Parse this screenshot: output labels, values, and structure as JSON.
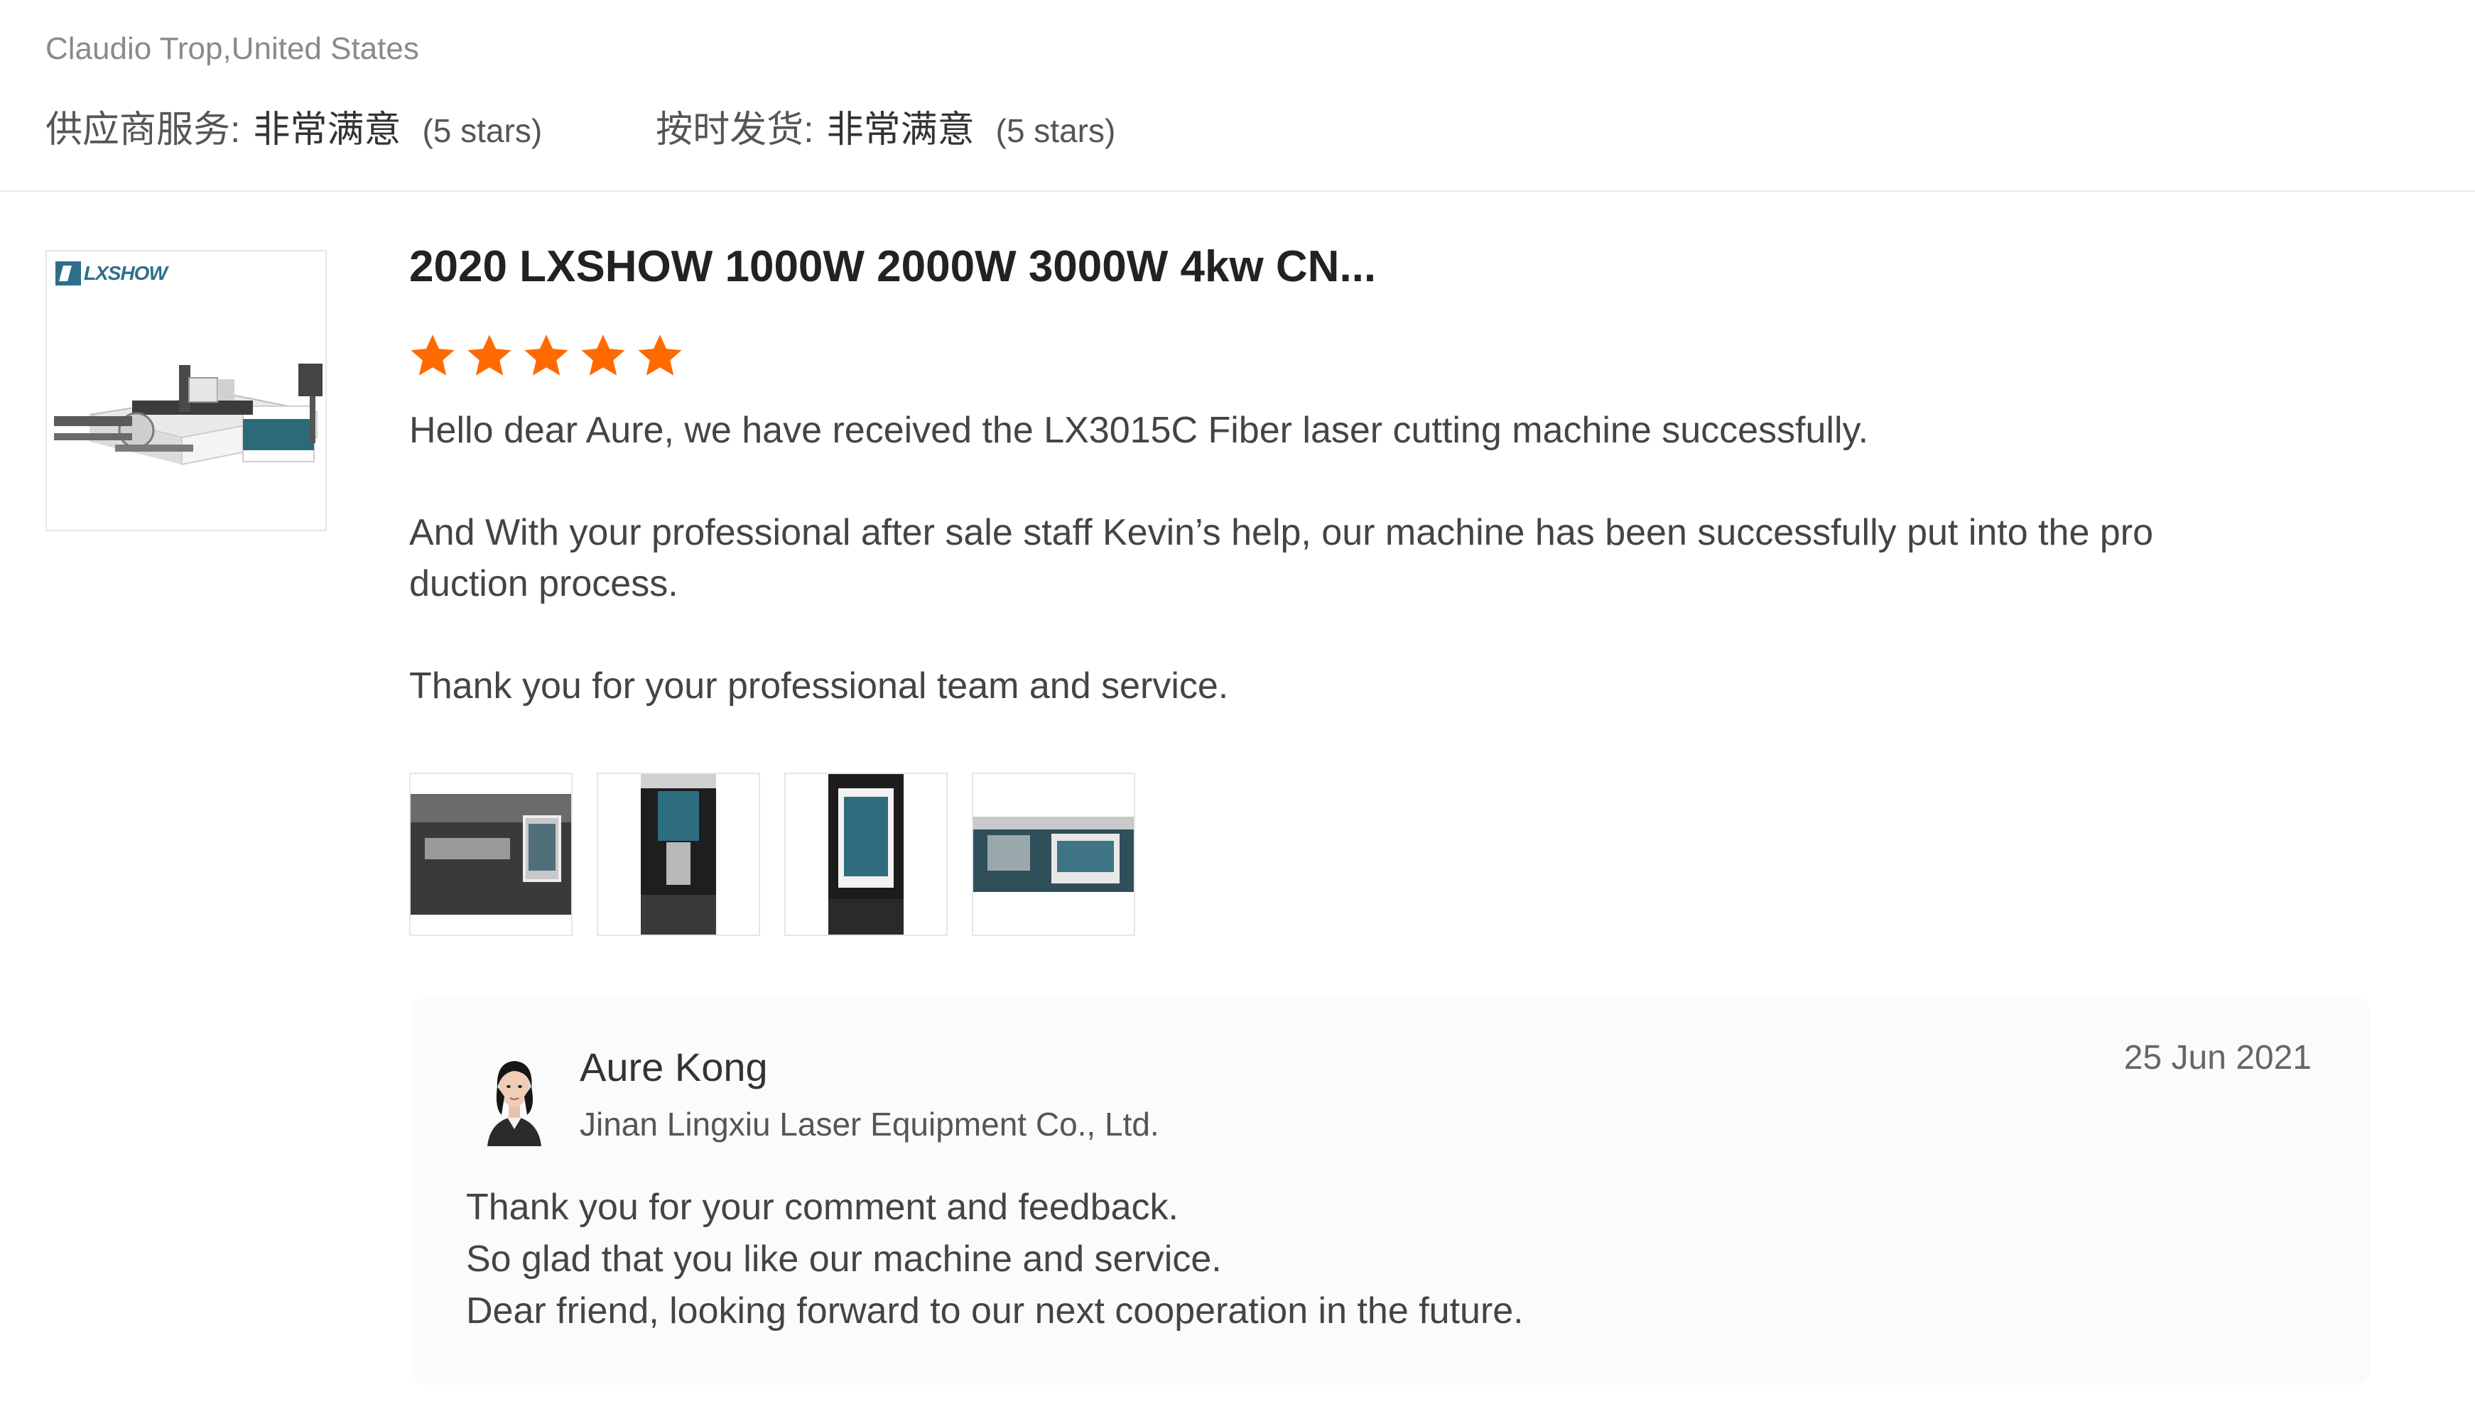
{
  "reviewer": {
    "name_location": "Claudio Trop,United States"
  },
  "ratings": [
    {
      "label": "供应商服务:",
      "value": "非常满意",
      "stars_text": "(5 stars)"
    },
    {
      "label": "按时发货:",
      "value": "非常满意",
      "stars_text": "(5 stars)"
    }
  ],
  "product": {
    "logo_text": "LXSHOW",
    "title": "2020 LXSHOW 1000W 2000W 3000W 4kw CN...",
    "rating": 5,
    "star_color": "#ff6a00"
  },
  "review": {
    "paragraphs": [
      "Hello dear Aure, we have received the LX3015C Fiber laser cutting machine successfully.",
      "And With your professional after sale staff  Kevin’s  help, our machine has been successfully put into the pro duction process.",
      "Thank you for your professional team and service."
    ],
    "photo_count": 4
  },
  "reply": {
    "name": "Aure Kong",
    "company": "Jinan Lingxiu Laser Equipment Co., Ltd.",
    "date": "25 Jun 2021",
    "lines": [
      "Thank you for your comment and feedback.",
      "So glad that you like our machine and service.",
      "Dear friend, looking forward to our next cooperation  in the future."
    ]
  }
}
